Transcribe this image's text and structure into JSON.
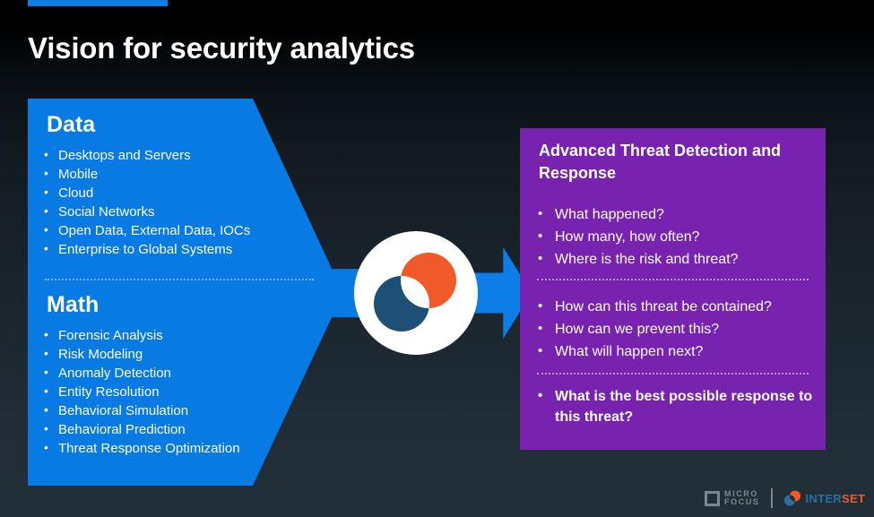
{
  "slide": {
    "title": "Vision for security analytics",
    "accent_blue": "#0d7ee8",
    "panel_blue": "#077ae3",
    "panel_purple": "#7823b0",
    "background_top": "#000000",
    "background_bottom": "#222f39"
  },
  "left_panel": {
    "sections": [
      {
        "heading": "Data",
        "items": [
          "Desktops and Servers",
          "Mobile",
          "Cloud",
          "Social Networks",
          "Open Data, External Data, IOCs",
          "Enterprise to Global Systems"
        ]
      },
      {
        "heading": "Math",
        "items": [
          "Forensic Analysis",
          "Risk Modeling",
          "Anomaly Detection",
          "Entity Resolution",
          "Behavioral Simulation",
          "Behavioral Prediction",
          "Threat Response Optimization"
        ]
      }
    ]
  },
  "right_panel": {
    "title": "Advanced Threat Detection and Response",
    "group_one": [
      "What happened?",
      "How many, how often?",
      "Where is the risk and threat?"
    ],
    "group_two": [
      "How can this threat be contained?",
      "How can we prevent this?",
      "What will happen next?"
    ],
    "final_question": "What is the best possible response to this threat?"
  },
  "footer": {
    "micro_focus": {
      "line1": "MICRO",
      "line2": "FOCUS"
    },
    "interset": {
      "part1": "INTER",
      "part2": "SET",
      "mark_orange": "#ef5a28",
      "mark_blue": "#2c6e9e"
    }
  },
  "center_mark": {
    "orange": "#ef5a28",
    "navy": "#1e4f77"
  }
}
